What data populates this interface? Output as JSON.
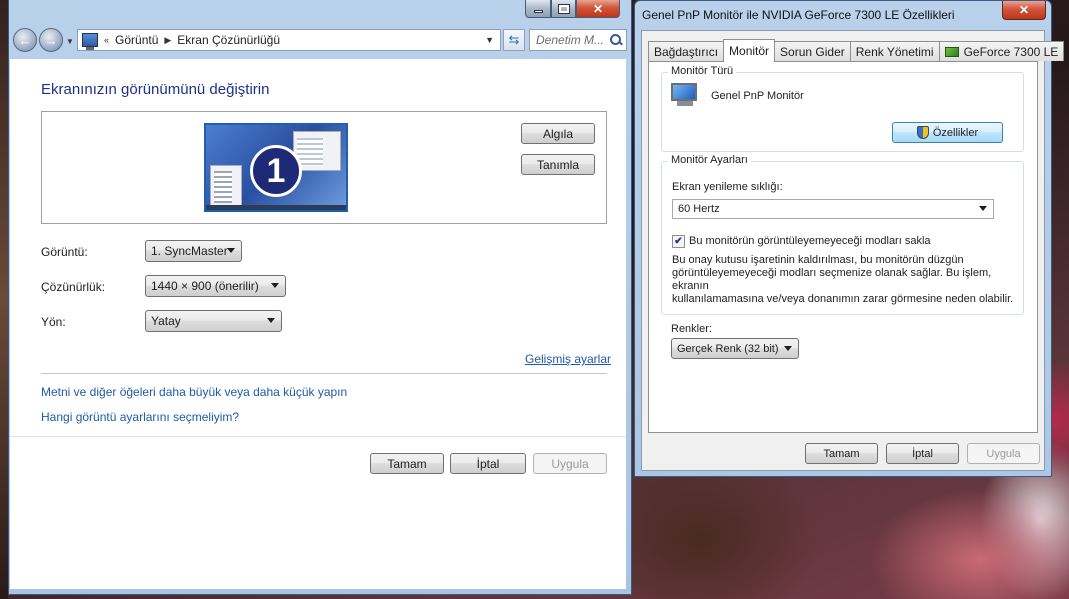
{
  "control_panel": {
    "breadcrumb": [
      "Görüntü",
      "Ekran Çözünürlüğü"
    ],
    "search_placeholder": "Denetim M...",
    "heading": "Ekranınızın görünümünü değiştirin",
    "monitor_number": "1",
    "detect_button": "Algıla",
    "identify_button": "Tanımla",
    "display_label": "Görüntü:",
    "display_value": "1. SyncMaster",
    "resolution_label": "Çözünürlük:",
    "resolution_value": "1440 × 900 (önerilir)",
    "orientation_label": "Yön:",
    "orientation_value": "Yatay",
    "advanced_link": "Gelişmiş ayarlar",
    "link_text_size": "Metni ve diğer öğeleri daha büyük veya daha küçük yapın",
    "link_which_settings": "Hangi görüntü ayarlarını seçmeliyim?",
    "ok_button": "Tamam",
    "cancel_button": "İptal",
    "apply_button": "Uygula"
  },
  "properties_dialog": {
    "title": "Genel PnP Monitör ile NVIDIA GeForce 7300 LE Özellikleri",
    "tabs": [
      "Bağdaştırıcı",
      "Monitör",
      "Sorun Gider",
      "Renk Yönetimi",
      "GeForce 7300 LE"
    ],
    "active_tab": "Monitör",
    "monitor_type_group": "Monitör Türü",
    "monitor_name": "Genel PnP Monitör",
    "properties_button": "Özellikler",
    "monitor_settings_group": "Monitör Ayarları",
    "refresh_label": "Ekran yenileme sıklığı:",
    "refresh_value": "60 Hertz",
    "hide_modes_checked": true,
    "hide_modes_label": "Bu monitörün görüntüleyemeyeceği modları sakla",
    "hide_modes_desc_1": "Bu onay kutusu işaretinin kaldırılması, bu monitörün düzgün",
    "hide_modes_desc_2": "görüntüleyemeyeceği modları seçmenize olanak sağlar. Bu işlem, ekranın",
    "hide_modes_desc_3": "kullanılamamasına ve/veya donanımın zarar görmesine neden olabilir.",
    "colors_label": "Renkler:",
    "colors_value": "Gerçek Renk (32 bit)",
    "ok_button": "Tamam",
    "cancel_button": "İptal",
    "apply_button": "Uygula"
  }
}
